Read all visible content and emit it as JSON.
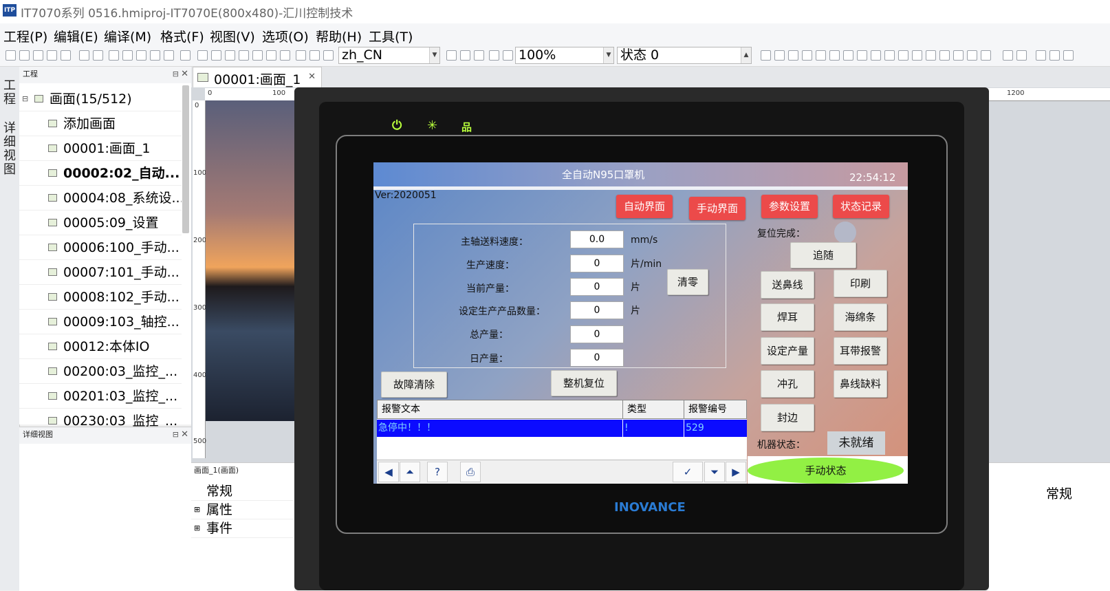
{
  "window": {
    "title": "IT7070系列 0516.hmiproj-IT7070E(800x480)-汇川控制技术",
    "icon_text": "ITP"
  },
  "menu": [
    "工程(P)",
    "编辑(E)",
    "编译(M)",
    "格式(F)",
    "视图(V)",
    "选项(O)",
    "帮助(H)",
    "工具(T)"
  ],
  "toolbar": {
    "language": "zh_CN",
    "zoom": "100%",
    "state": "状态 0"
  },
  "side_tabs": {
    "project": "工程",
    "detail": "详细视图"
  },
  "project_panel": {
    "title": "工程",
    "items": [
      {
        "label": "画面(15/512)",
        "bold": false
      },
      {
        "label": "添加画面",
        "bold": false
      },
      {
        "label": "00001:画面_1",
        "bold": false
      },
      {
        "label": "00002:02_自动...",
        "bold": true
      },
      {
        "label": "00004:08_系统设...",
        "bold": false
      },
      {
        "label": "00005:09_设置",
        "bold": false
      },
      {
        "label": "00006:100_手动...",
        "bold": false
      },
      {
        "label": "00007:101_手动...",
        "bold": false
      },
      {
        "label": "00008:102_手动...",
        "bold": false
      },
      {
        "label": "00009:103_轴控...",
        "bold": false
      },
      {
        "label": "00012:本体IO",
        "bold": false
      },
      {
        "label": "00200:03_监控_...",
        "bold": false
      },
      {
        "label": "00201:03_监控_...",
        "bold": false
      },
      {
        "label": "00230:03_监控_...",
        "bold": false
      }
    ]
  },
  "detail_panel": {
    "title": "详细视图"
  },
  "doc_tab": {
    "label": "00001:画面_1"
  },
  "ruler": {
    "h_ticks": [
      "0",
      "100",
      "1200"
    ],
    "v_ticks": [
      "0",
      "100",
      "200",
      "300",
      "400",
      "500"
    ]
  },
  "props_panel": {
    "title": "画面_1(画面)",
    "rows": [
      "常规",
      "属性",
      "事件"
    ],
    "right_label": "常规"
  },
  "device": {
    "brand": "INOVANCE"
  },
  "hmi": {
    "title": "全自动N95口罩机",
    "time": "22:54:12",
    "version": "Ver:2020051",
    "nav_buttons": [
      "自动界面",
      "手动界面",
      "参数设置",
      "状态记录"
    ],
    "params": [
      {
        "label": "主轴送料速度：",
        "value": "0.0",
        "unit": "mm/s"
      },
      {
        "label": "生产速度：",
        "value": "0",
        "unit": "片/min"
      },
      {
        "label": "当前产量：",
        "value": "0",
        "unit": "片"
      },
      {
        "label": "设定生产产品数量：",
        "value": "0",
        "unit": "片"
      },
      {
        "label": "总产量：",
        "value": "0",
        "unit": ""
      },
      {
        "label": "日产量：",
        "value": "0",
        "unit": ""
      }
    ],
    "clear_button": "清零",
    "fault_clear_button": "故障清除",
    "machine_reset_button": "整机复位",
    "reset_done_label": "复位完成：",
    "follow_button": "追随",
    "function_buttons": [
      "送鼻线",
      "印刷",
      "焊耳",
      "海绵条",
      "设定产量",
      "耳带报警",
      "冲孔",
      "鼻线缺料",
      "封边"
    ],
    "machine_state_label": "机器状态：",
    "machine_state_value": "未就绪",
    "mode_label": "手动状态",
    "alarm": {
      "headers": [
        "报警文本",
        "类型",
        "报警编号"
      ],
      "rows": [
        {
          "text": "急停中！！！",
          "type": "!",
          "code": "529"
        }
      ]
    }
  }
}
